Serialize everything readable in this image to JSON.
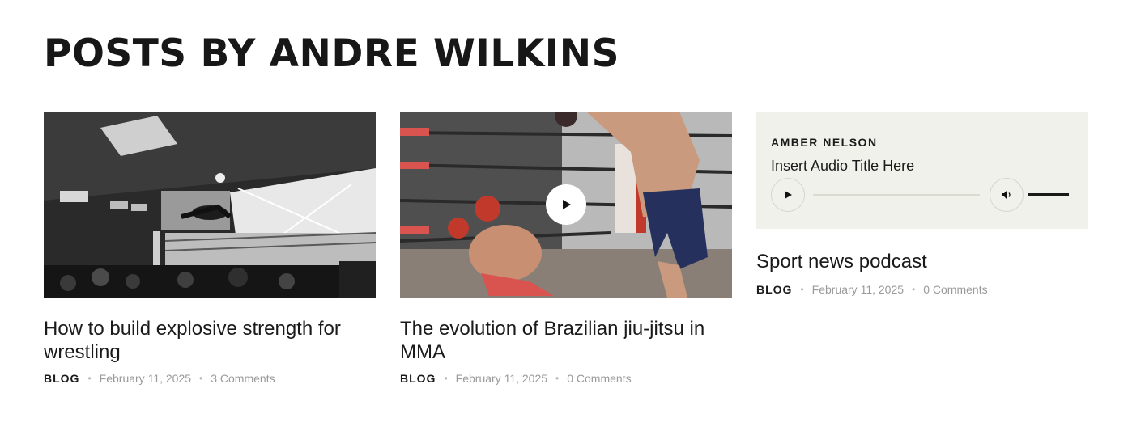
{
  "page": {
    "title": "POSTS BY ANDRE WILKINS"
  },
  "posts": [
    {
      "image": "wrestling-arena-photo",
      "title": "How to build explosive strength for wrestling",
      "category": "BLOG",
      "date": "February 11, 2025",
      "comments": "3 Comments"
    },
    {
      "image": "boxing-knockdown-photo",
      "has_video": true,
      "title": "The evolution of Brazilian jiu-jitsu in MMA",
      "category": "BLOG",
      "date": "February 11, 2025",
      "comments": "0 Comments"
    },
    {
      "audio": {
        "artist": "AMBER NELSON",
        "track_title": "Insert Audio Title Here",
        "progress": 0,
        "volume": 1.0
      },
      "title": "Sport news podcast",
      "category": "BLOG",
      "date": "February 11, 2025",
      "comments": "0 Comments"
    }
  ],
  "icons": {
    "play": "play-icon",
    "volume": "volume-icon",
    "separator": "•"
  },
  "colors": {
    "audio_bg": "#f1f1ec",
    "meta_text": "#9a9a9a",
    "heading": "#171717"
  }
}
